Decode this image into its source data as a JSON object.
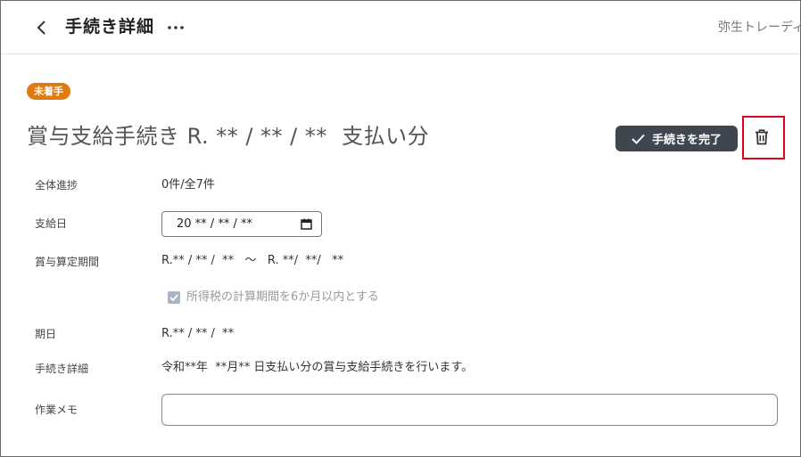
{
  "header": {
    "title": "手続き詳細",
    "company_name": "弥生トレーディング"
  },
  "status_badge": "未着手",
  "page_title": "賞与支給手続き R. ** / ** / **  支払い分",
  "actions": {
    "complete_label": "手続きを完了"
  },
  "fields": {
    "progress": {
      "label": "全体進捗",
      "value": "0件/全7件"
    },
    "pay_date": {
      "label": "支給日",
      "value": "20 ** / ** / **"
    },
    "calc_period": {
      "label": "賞与算定期間",
      "value": "R.** / ** /  **   ～   R. **/  **/   **"
    },
    "six_month_check": {
      "label": "所得税の計算期間を6か月以内とする",
      "checked": true
    },
    "deadline": {
      "label": "期日",
      "value": "R.** / ** /  **"
    },
    "detail": {
      "label": "手続き詳細",
      "value": "令和**年  **月** 日支払い分の賞与支給手続きを行います。"
    },
    "memo": {
      "label": "作業メモ",
      "value": ""
    }
  },
  "colors": {
    "badge": "#e07b12",
    "complete_button": "#3f4650",
    "highlight": "#e1001e"
  },
  "icons": [
    "chevron-left-icon",
    "more-horizontal-icon",
    "check-icon",
    "trash-icon",
    "calendar-icon",
    "checkbox-check-icon"
  ]
}
